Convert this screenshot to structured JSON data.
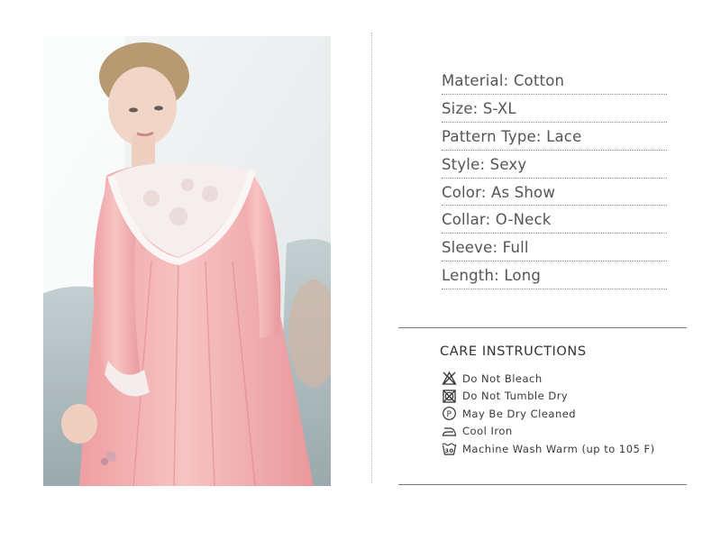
{
  "specs": [
    {
      "label": "Material: Cotton"
    },
    {
      "label": "Size: S-XL"
    },
    {
      "label": "Pattern Type: Lace"
    },
    {
      "label": "Style: Sexy"
    },
    {
      "label": "Color: As Show"
    },
    {
      "label": "Collar: O-Neck"
    },
    {
      "label": "Sleeve: Full"
    },
    {
      "label": "Length: Long"
    }
  ],
  "care": {
    "title": "CARE  INSTRUCTIONS",
    "items": [
      {
        "icon": "do-not-bleach-icon",
        "text": "Do  Not  Bleach"
      },
      {
        "icon": "do-not-tumble-dry-icon",
        "text": "Do  Not  Tumble  Dry"
      },
      {
        "icon": "dry-clean-p-icon",
        "text": "May  Be  Dry  Cleaned"
      },
      {
        "icon": "iron-icon",
        "text": "Cool  Iron"
      },
      {
        "icon": "wash-30-icon",
        "text": "Machine  Wash  Warm  (up  to  105  F)"
      }
    ]
  },
  "colors": {
    "dress": "#f4b9b8",
    "lace": "#f7eeee",
    "text": "#555555",
    "divider": "#7a7a7a"
  }
}
